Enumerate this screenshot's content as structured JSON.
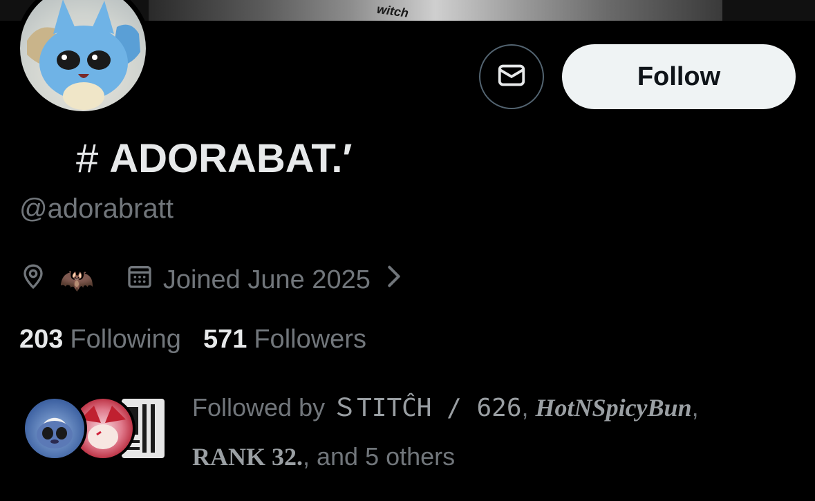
{
  "banner": {
    "tag_text": "witch"
  },
  "profile": {
    "display_name": "ADORABAT.′",
    "name_prefix": "#",
    "handle": "@adorabratt",
    "location_emoji": "🦇",
    "joined": "Joined June 2025"
  },
  "actions": {
    "follow_label": "Follow"
  },
  "stats": {
    "following_count": "203",
    "following_label": "Following",
    "followers_count": "571",
    "followers_label": "Followers"
  },
  "followed_by": {
    "prefix": "Followed by ",
    "user1": "ＳTITĈH / 626",
    "sep1": ", ",
    "user2": "HotNSpicyBun",
    "sep2": ",",
    "user3": "RANK 32.",
    "suffix": ", and 5 others"
  },
  "colors": {
    "background": "#000000",
    "primary_text": "#e7e9ea",
    "secondary_text": "#71767b",
    "follow_bg": "#eff3f4",
    "border": "#536471"
  },
  "icons": [
    "location-pin-icon",
    "calendar-icon",
    "chevron-right-icon",
    "mail-icon"
  ]
}
